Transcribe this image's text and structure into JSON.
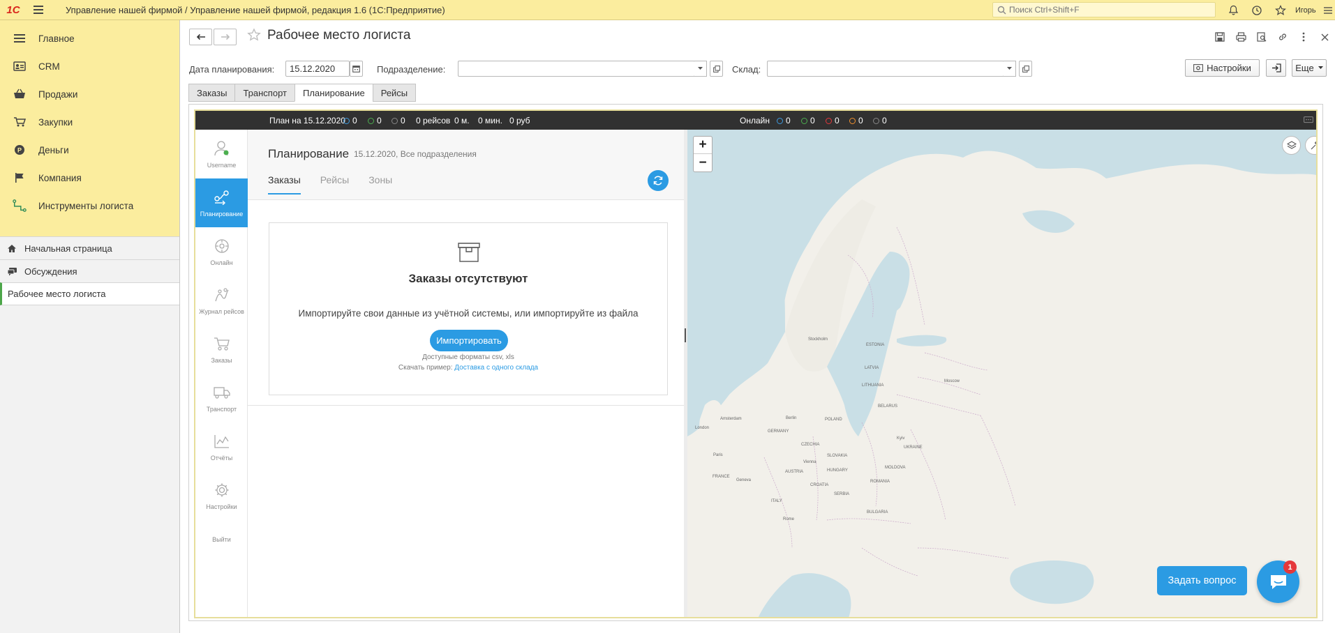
{
  "topbar": {
    "logo": "1С",
    "title": "Управление нашей фирмой / Управление нашей фирмой, редакция 1.6  (1С:Предприятие)",
    "search_placeholder": "Поиск Ctrl+Shift+F",
    "user": "Игорь"
  },
  "sidebar": {
    "items": [
      {
        "label": "Главное",
        "icon": "menu-icon"
      },
      {
        "label": "CRM",
        "icon": "crm-icon"
      },
      {
        "label": "Продажи",
        "icon": "basket-icon"
      },
      {
        "label": "Закупки",
        "icon": "cart-icon"
      },
      {
        "label": "Деньги",
        "icon": "coin-icon"
      },
      {
        "label": "Компания",
        "icon": "flag-icon"
      },
      {
        "label": "Инструменты логиста",
        "icon": "route-icon"
      }
    ],
    "home": "Начальная страница",
    "discussions": "Обсуждения",
    "open_form": "Рабочее место логиста"
  },
  "form": {
    "title": "Рабочее место логиста",
    "date_label": "Дата планирования:",
    "date_value": "15.12.2020",
    "division_label": "Подразделение:",
    "division_value": "",
    "warehouse_label": "Склад:",
    "warehouse_value": "",
    "settings_button": "Настройки",
    "more_button": "Еще",
    "tabs": [
      "Заказы",
      "Транспорт",
      "Планирование",
      "Рейсы"
    ],
    "active_tab": "Планирование"
  },
  "status_bar": {
    "plan_label": "План на 15.12.2020",
    "plan_counts": [
      "0",
      "0",
      "0"
    ],
    "trips": "0 рейсов",
    "meters": "0 м.",
    "minutes": "0 мин.",
    "rub": "0 руб",
    "online_label": "Онлайн",
    "online_counts": [
      "0",
      "0",
      "0",
      "0",
      "0"
    ],
    "colors": {
      "blue": "#3d9be0",
      "green": "#4caf50",
      "gray": "#888888",
      "red": "#e5383b",
      "orange": "#f0902e"
    }
  },
  "left_nav": [
    {
      "label": "Username",
      "icon": "user-icon"
    },
    {
      "label": "Планирование",
      "icon": "planning-icon"
    },
    {
      "label": "Онлайн",
      "icon": "online-icon"
    },
    {
      "label": "Журнал рейсов",
      "icon": "trips-journal-icon"
    },
    {
      "label": "Заказы",
      "icon": "cart-icon"
    },
    {
      "label": "Транспорт",
      "icon": "truck-icon"
    },
    {
      "label": "Отчёты",
      "icon": "chart-icon"
    },
    {
      "label": "Настройки",
      "icon": "gear-icon"
    },
    {
      "label": "Выйти",
      "icon": ""
    }
  ],
  "planning": {
    "title": "Планирование",
    "subtitle": "15.12.2020, Все подразделения",
    "tabs": [
      "Заказы",
      "Рейсы",
      "Зоны"
    ],
    "empty_title": "Заказы отсутствуют",
    "empty_text": "Импортируйте свои данные из учётной системы, или импортируйте из файла",
    "import_button": "Импортировать",
    "formats": "Доступные форматы csv, xls",
    "sample_label": "Скачать пример:",
    "sample_link": "Доставка с одного склада"
  },
  "map": {
    "zoom_in": "+",
    "zoom_out": "−",
    "labels": {
      "stockholm": "Stockholm",
      "estonia": "ESTONIA",
      "latvia": "LATVIA",
      "lithuania": "LITHUANIA",
      "moscow": "Moscow",
      "belarus": "BELARUS",
      "poland": "POLAND",
      "berlin": "Berlin",
      "amsterdam": "Amsterdam",
      "london": "London",
      "germany": "GERMANY",
      "paris": "Paris",
      "france": "FRANCE",
      "geneva": "Geneva",
      "vienna": "Vienna",
      "austria": "AUSTRIA",
      "czechia": "CZECHIA",
      "slovakia": "SLOVAKIA",
      "hungary": "HUNGARY",
      "romania": "ROMANIA",
      "kyiv": "Kyiv",
      "ukraine": "UKRAINE",
      "moldova": "MOLDOVA",
      "serbia": "SERBIA",
      "bulgaria": "BULGARIA",
      "croatia": "CROATIA",
      "italy": "ITALY",
      "rome": "Rome"
    }
  },
  "support": {
    "ask_button": "Задать вопрос",
    "chat_badge": "1"
  }
}
